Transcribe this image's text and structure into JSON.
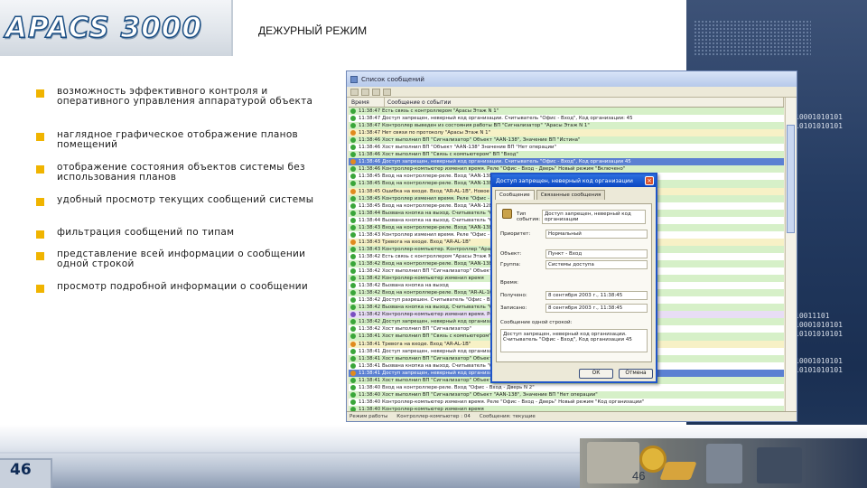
{
  "header": {
    "logo_text": "APACS 3000",
    "title": "ДЕЖУРНЫЙ РЕЖИМ"
  },
  "bullets": [
    {
      "text": "возможность эффективного контроля и оперативного управления аппаратурой объекта"
    },
    {
      "text": "наглядное графическое отображение планов помещений"
    },
    {
      "text": "отображение состояния объектов системы без использования планов"
    },
    {
      "text": "удобный просмотр текущих сообщений системы"
    },
    {
      "text": "фильтрация сообщений по типам"
    },
    {
      "text": "представление всей информации о сообщении одной строкой"
    },
    {
      "text": "просмотр подробной информации о сообщении"
    }
  ],
  "app_window": {
    "title": "Список сообщений",
    "columns": [
      "Время",
      "Сообщение о событии"
    ],
    "rows": [
      {
        "time": "11:38:47",
        "msg": "Есть связь с контроллером \"Арасы Этаж N 1\"",
        "color": "g"
      },
      {
        "time": "11:38:47",
        "msg": "Доступ запрещен, неверный код организации. Считыватель \"Офис - Вход\", Код организации: 45",
        "color": "w"
      },
      {
        "time": "11:38:47",
        "msg": "Контроллер выведен из состояния работы ВП \"Сигнализатор\" \"Арасы Этаж N 1\"",
        "color": "g"
      },
      {
        "time": "11:38:47",
        "msg": "Нет связи по протоколу \"Арасы Этаж N 1\"",
        "color": "y"
      },
      {
        "time": "11:38:46",
        "msg": "Хост выполнил ВП \"Сигнализатор\" Объект \"AAN-138\", Значение ВП \"Истина\"",
        "color": "g"
      },
      {
        "time": "11:38:46",
        "msg": "Хост выполнил ВП \"Объект \"AAN-138\" Значение ВП \"Нет операции\"",
        "color": "w"
      },
      {
        "time": "11:38:46",
        "msg": "Хост выполнил ВП \"Связь с компьютером\" ВП \"Вход\"",
        "color": "g"
      },
      {
        "time": "11:38:46",
        "msg": "Доступ запрещен, неверный код организации. Считыватель \"Офис - Вход\", Код организации 45",
        "color": "b"
      },
      {
        "time": "11:38:46",
        "msg": "Контроллер-компьютер изменил время. Реле \"Офис - Вход - Дверь\" Новый режим \"Включено\"",
        "color": "g"
      },
      {
        "time": "11:38:45",
        "msg": "Вход на контроллере-реле. Вход \"AAN-138\", Новое состояние \"Нормальное\"",
        "color": "w"
      },
      {
        "time": "11:38:45",
        "msg": "Вход на контроллере-реле. Вход \"AAN-138\", Сигнал \"Тревога\"",
        "color": "g"
      },
      {
        "time": "11:38:45",
        "msg": "Ошибка на входе. Вход \"AR-AL-1B\", Новое состояние \"Нормальное\"",
        "color": "y"
      },
      {
        "time": "11:38:45",
        "msg": "Контроллер изменил время. Реле \"Офис - Вход - Дверь\"",
        "color": "g"
      },
      {
        "time": "11:38:45",
        "msg": "Вход на контроллере-реле. Вход \"AAN-128\"",
        "color": "w"
      },
      {
        "time": "11:38:44",
        "msg": "Вызвана кнопка на выход. Считыватель \"Офис - Вход\"",
        "color": "g"
      },
      {
        "time": "11:38:44",
        "msg": "Вызвана кнопка на выход. Считыватель \"Офис - Вход\"",
        "color": "w"
      },
      {
        "time": "11:38:43",
        "msg": "Вход на контроллере-реле. Вход \"AAN-138\"",
        "color": "g"
      },
      {
        "time": "11:38:43",
        "msg": "Контроллер изменил время. Реле \"Офис - Вход\"",
        "color": "w"
      },
      {
        "time": "11:38:43",
        "msg": "Тревога на входе. Вход \"AR-AL-1B\"",
        "color": "y"
      },
      {
        "time": "11:38:43",
        "msg": "Контроллер-компьютер. Контроллер \"Арасы Этаж N 1\"",
        "color": "g"
      },
      {
        "time": "11:38:42",
        "msg": "Есть связь с контроллером \"Арасы Этаж N 1\"",
        "color": "w"
      },
      {
        "time": "11:38:42",
        "msg": "Вход на контроллере-реле. Вход \"AAN-138\"",
        "color": "g"
      },
      {
        "time": "11:38:42",
        "msg": "Хост выполнил ВП \"Сигнализатор\" Объект \"AAN-138\"",
        "color": "w"
      },
      {
        "time": "11:38:42",
        "msg": "Контроллер-компьютер изменил время",
        "color": "g"
      },
      {
        "time": "11:38:42",
        "msg": "Вызвана кнопка на выход",
        "color": "w"
      },
      {
        "time": "11:38:42",
        "msg": "Вход на контроллере-реле. Вход \"AR-AL-108\"",
        "color": "g"
      },
      {
        "time": "11:38:42",
        "msg": "Доступ разрешен. Считыватель \"Офис - Вход\"",
        "color": "w"
      },
      {
        "time": "11:38:42",
        "msg": "Вызвана кнопка на выход. Считыватель \"Офис - Вход\"",
        "color": "g"
      },
      {
        "time": "11:38:42",
        "msg": "Контроллер-компьютер изменил время. Реле \"Офис - Вход\"",
        "color": "p"
      },
      {
        "time": "11:38:42",
        "msg": "Доступ запрещен, неверный код организации. Считыватель \"Офис - Вход\"",
        "color": "g"
      },
      {
        "time": "11:38:42",
        "msg": "Хост выполнил ВП \"Сигнализатор\"",
        "color": "w"
      },
      {
        "time": "11:38:41",
        "msg": "Хост выполнил ВП \"Связь с компьютером\"",
        "color": "g"
      },
      {
        "time": "11:38:41",
        "msg": "Тревога на входе. Вход \"AR-AL-1B\"",
        "color": "y"
      },
      {
        "time": "11:38:41",
        "msg": "Доступ запрещен, неверный код организации",
        "color": "w"
      },
      {
        "time": "11:38:41",
        "msg": "Хост выполнил ВП \"Сигнализатор\" Объект \"AAN-138\"",
        "color": "g"
      },
      {
        "time": "11:38:41",
        "msg": "Вызвана кнопка на выход. Считыватель \"Офис - Вход\"",
        "color": "w"
      },
      {
        "time": "11:38:41",
        "msg": "Доступ запрещен, неверный код организации. Считыватель \"Офис - Вход\", Код организации N 5",
        "color": "b"
      },
      {
        "time": "11:38:41",
        "msg": "Хост выполнил ВП \"Сигнализатор\" Объект \"AAN-138\", Значение ВП \"Нет операции\"",
        "color": "g"
      },
      {
        "time": "11:38:40",
        "msg": "Вход на контроллере-реле. Вход \"Офис - Вход - Дверь N 2\"",
        "color": "w"
      },
      {
        "time": "11:38:40",
        "msg": "Хост выполнил ВП \"Сигнализатор\" Объект \"AAN-138\", Значение ВП \"Нет операции\"",
        "color": "g"
      },
      {
        "time": "11:38:40",
        "msg": "Контроллер-компьютер изменил время. Реле \"Офис - Вход - Дверь\" Новый режим \"Код организации\"",
        "color": "w"
      },
      {
        "time": "11:38:40",
        "msg": "Контроллер-компьютер изменил время",
        "color": "g"
      }
    ],
    "status": {
      "mode": "Режим работы",
      "filter": "Контроллер-компьютер : 04",
      "count": "Сообщения: текущие"
    }
  },
  "dialog": {
    "title": "Доступ запрещен, неверный код организации",
    "tabs": [
      "Сообщение",
      "Связанные сообщения"
    ],
    "fields": [
      {
        "label": "Тип события:",
        "value": "Доступ запрещен, неверный код организации"
      },
      {
        "label": "Приоритет:",
        "value": "Нормальный"
      },
      {
        "label": "Объект:",
        "value": "Пункт - Вход"
      },
      {
        "label": "Группа:",
        "value": "Системы доступа"
      },
      {
        "label": "Время:",
        "value": ""
      },
      {
        "label": "Получено:",
        "value": "8 сентября 2003 г., 11:38:45"
      },
      {
        "label": "Записано:",
        "value": "8 сентября 2003 г., 11:38:45"
      }
    ],
    "description_label": "Сообщение одной строкой:",
    "description": "Доступ запрещен, неверный код организации. Считыватель \"Офис - Вход\", Код организации 45",
    "ok_label": "ОК",
    "cancel_label": "Отмена"
  },
  "page_number": "46",
  "page_number_secondary": "46",
  "colors": {
    "bullet": "#f0b400",
    "row_green": "#d6f0c8",
    "row_selected": "#5b80d2",
    "panel_dark": "#243b61"
  }
}
